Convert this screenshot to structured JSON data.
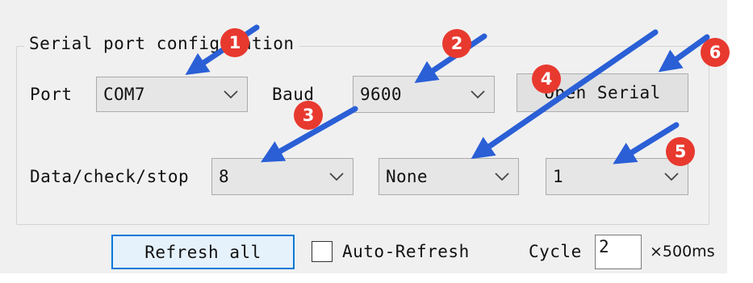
{
  "window": {
    "group_title": "Serial port configuration",
    "port": {
      "label": "Port",
      "selected": "COM7"
    },
    "baud": {
      "label": "Baud",
      "selected": "9600"
    },
    "open_serial_label": "Open Serial",
    "data_check_stop": {
      "label": "Data/check/stop",
      "data_bits": "8",
      "parity": "None",
      "stop_bits": "1"
    },
    "refresh_all_label": "Refresh all",
    "auto_refresh": {
      "label": "Auto-Refresh",
      "checked": false
    },
    "cycle": {
      "label": "Cycle",
      "value": "2",
      "unit": "×500ms"
    }
  },
  "annotations": {
    "badges": [
      "1",
      "2",
      "3",
      "4",
      "5",
      "6"
    ],
    "badge_color": "#e8392f",
    "arrow_color": "#2a5fd6"
  },
  "colors": {
    "focus_border": "#0078d7",
    "focus_fill": "#e5f1fb",
    "panel_bg": "#f0f0f0"
  }
}
